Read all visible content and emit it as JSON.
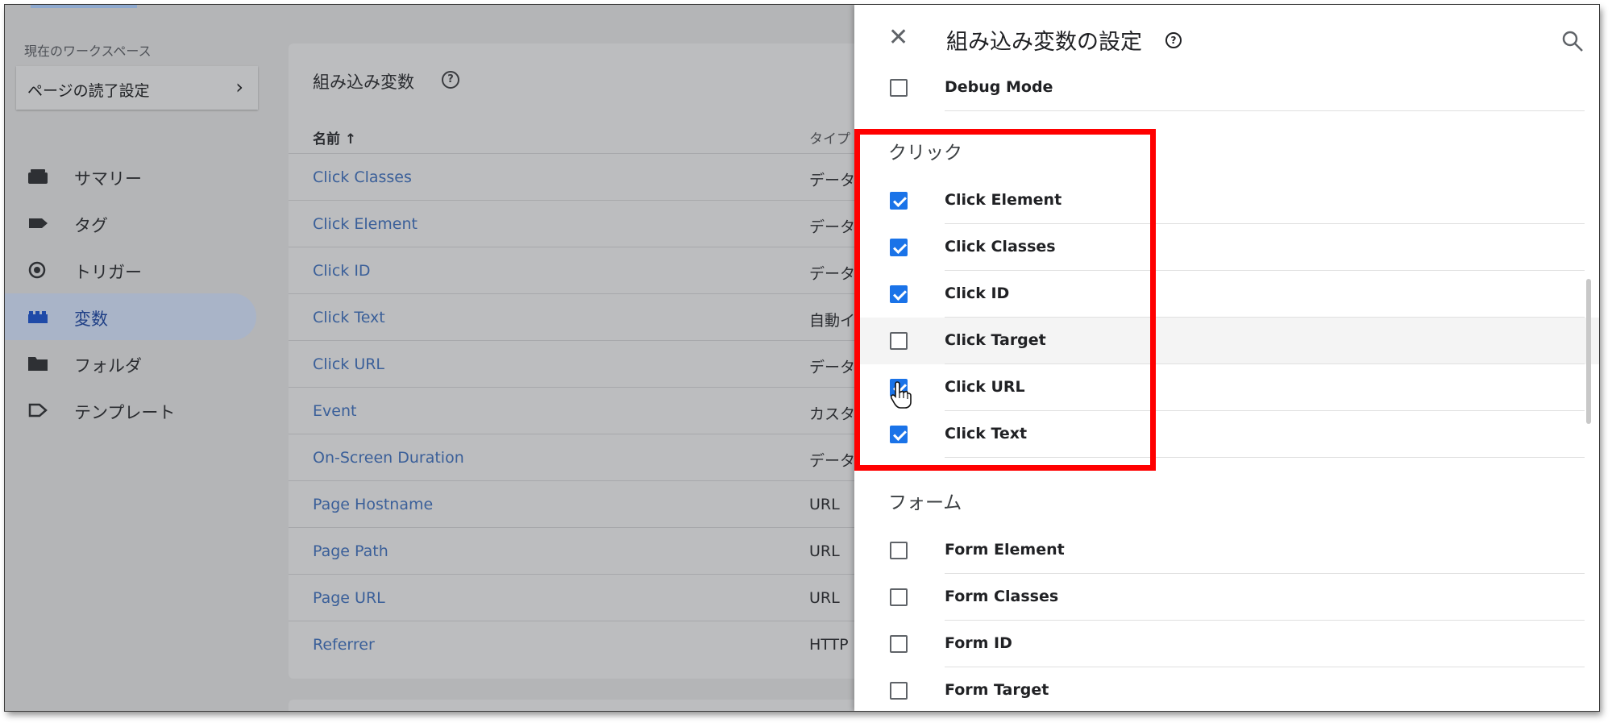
{
  "sidebar": {
    "workspace_label": "現在のワークスペース",
    "workspace_name": "ページの読了設定",
    "items": [
      {
        "label": "サマリー",
        "icon": "summary-icon"
      },
      {
        "label": "タグ",
        "icon": "tag-icon"
      },
      {
        "label": "トリガー",
        "icon": "trigger-icon"
      },
      {
        "label": "変数",
        "icon": "variables-icon",
        "active": true
      },
      {
        "label": "フォルダ",
        "icon": "folder-icon"
      },
      {
        "label": "テンプレート",
        "icon": "template-icon"
      }
    ]
  },
  "main": {
    "card_title": "組み込み変数",
    "columns": {
      "name": "名前 ↑",
      "type": "タイプ"
    },
    "rows": [
      {
        "name": "Click Classes",
        "type": "データ"
      },
      {
        "name": "Click Element",
        "type": "データ"
      },
      {
        "name": "Click ID",
        "type": "データ"
      },
      {
        "name": "Click Text",
        "type": "自動イ"
      },
      {
        "name": "Click URL",
        "type": "データ"
      },
      {
        "name": "Event",
        "type": "カスタ"
      },
      {
        "name": "On-Screen Duration",
        "type": "データ"
      },
      {
        "name": "Page Hostname",
        "type": "URL"
      },
      {
        "name": "Page Path",
        "type": "URL"
      },
      {
        "name": "Page URL",
        "type": "URL"
      },
      {
        "name": "Referrer",
        "type": "HTTP"
      }
    ]
  },
  "drawer": {
    "title": "組み込み変数の設定",
    "top_items": [
      {
        "label": "Debug Mode",
        "checked": false
      }
    ],
    "click_section": {
      "heading": "クリック",
      "items": [
        {
          "label": "Click Element",
          "checked": true
        },
        {
          "label": "Click Classes",
          "checked": true
        },
        {
          "label": "Click ID",
          "checked": true
        },
        {
          "label": "Click Target",
          "checked": false
        },
        {
          "label": "Click URL",
          "checked": true
        },
        {
          "label": "Click Text",
          "checked": true
        }
      ]
    },
    "form_section": {
      "heading": "フォーム",
      "items": [
        {
          "label": "Form Element",
          "checked": false
        },
        {
          "label": "Form Classes",
          "checked": false
        },
        {
          "label": "Form ID",
          "checked": false
        },
        {
          "label": "Form Target",
          "checked": false
        }
      ]
    }
  },
  "colors": {
    "accent": "#1a73e8",
    "highlight": "#ff0000",
    "link": "#3a5f99"
  }
}
